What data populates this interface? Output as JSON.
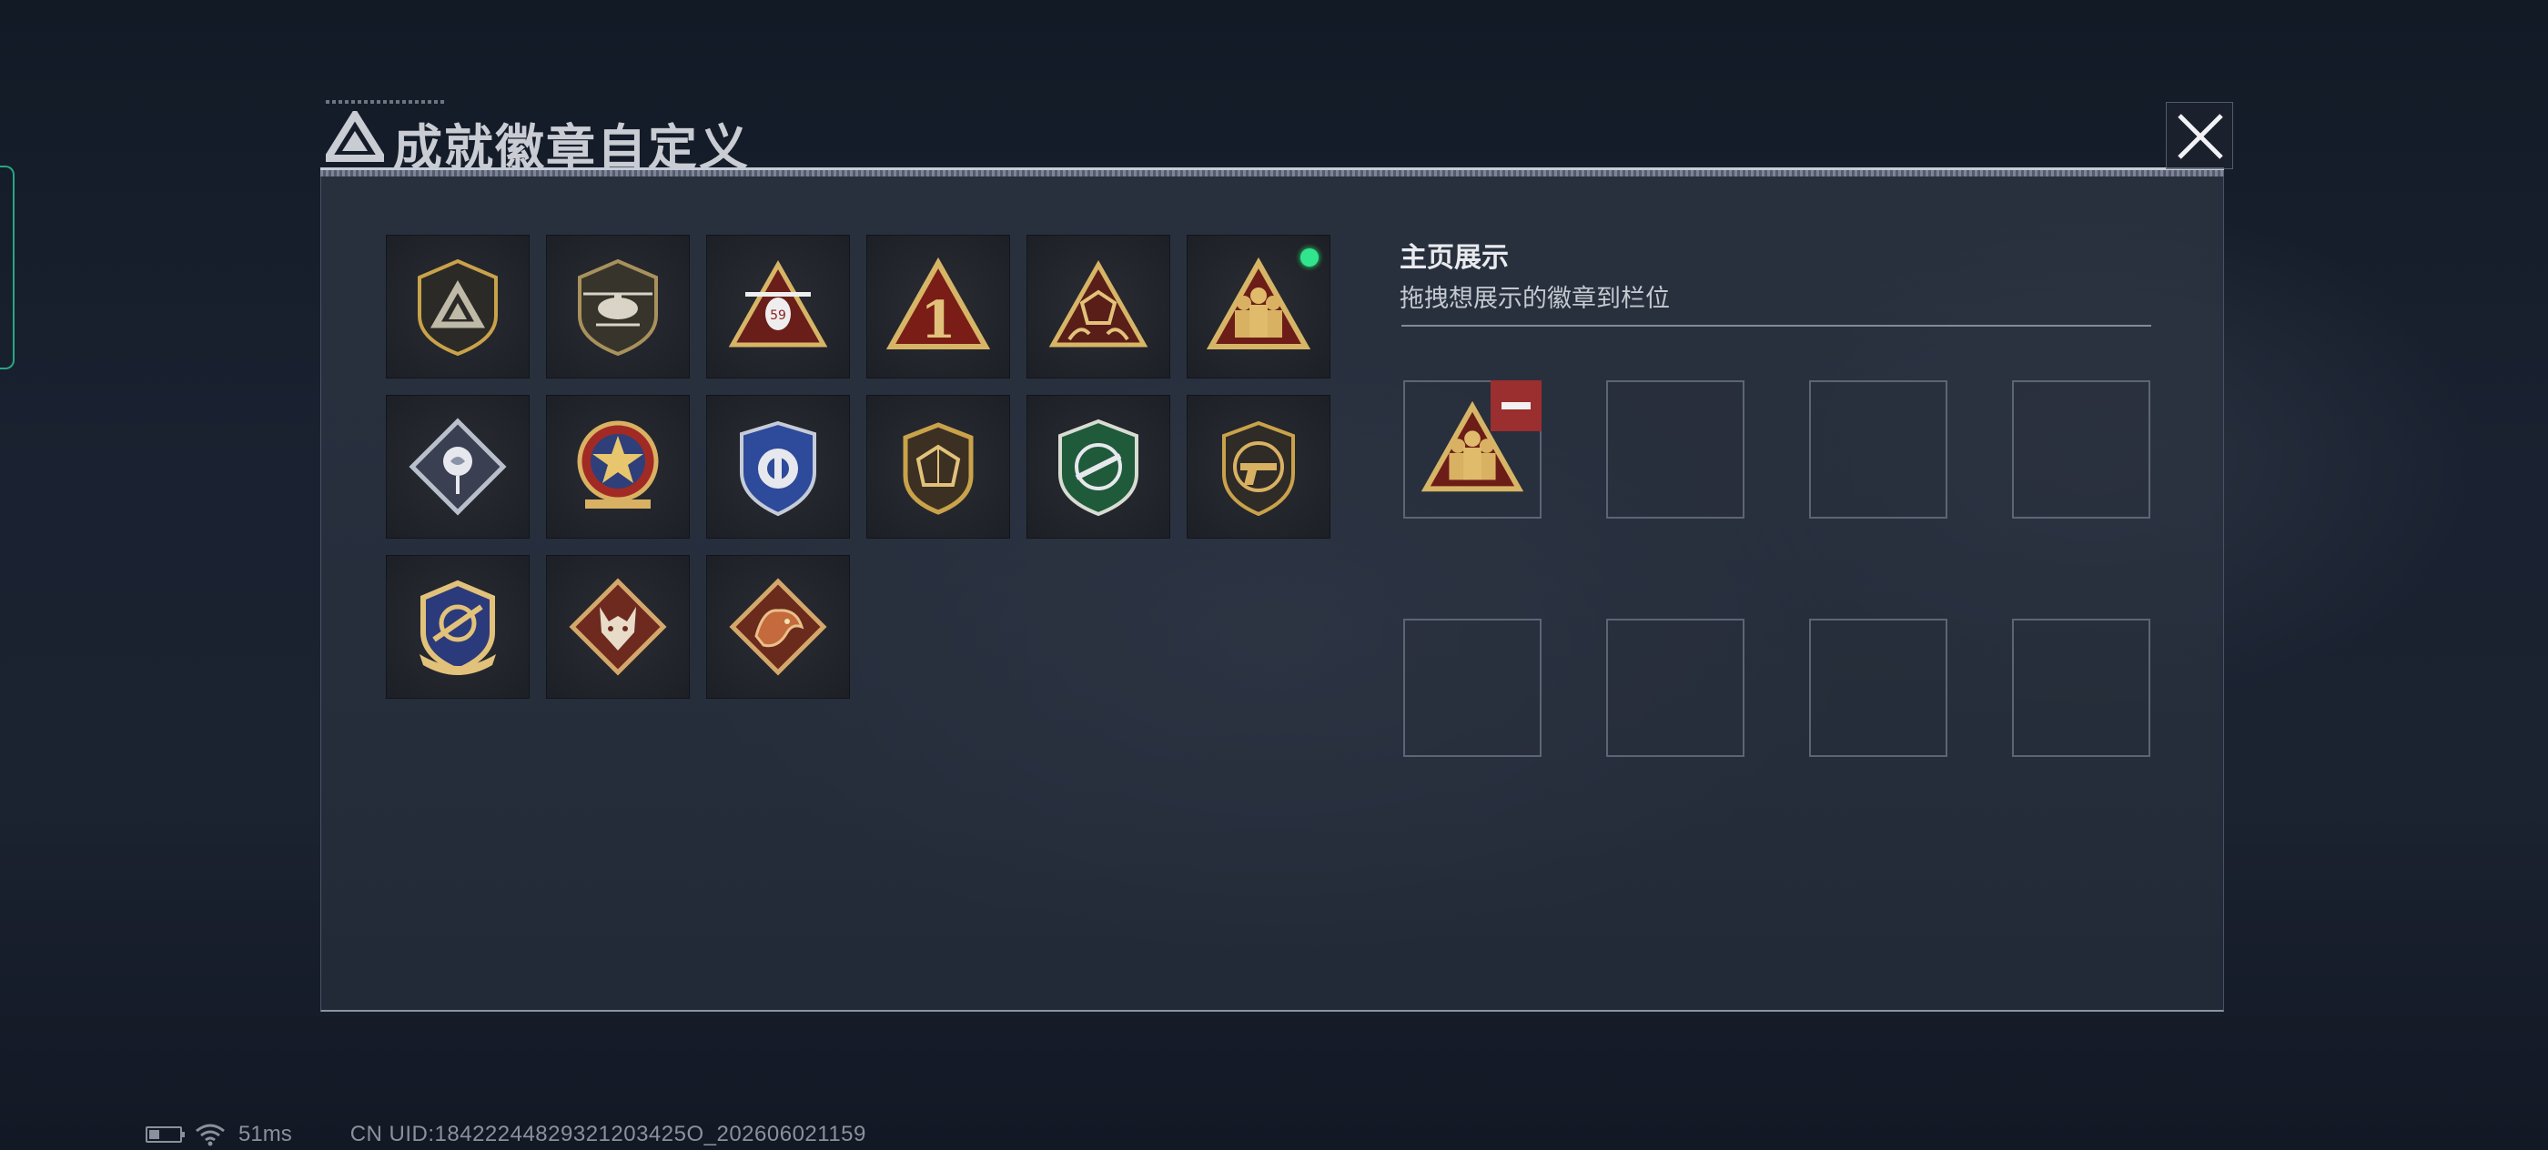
{
  "dialog": {
    "title": "成就徽章自定义",
    "close_icon": "close-icon"
  },
  "badges": [
    {
      "name": "delta-emblem-shield-badge",
      "equipped": false
    },
    {
      "name": "helicopter-shield-badge",
      "equipped": false
    },
    {
      "name": "helicopter-triangle-badge",
      "equipped": false
    },
    {
      "name": "number-one-triangle-badge",
      "equipped": false
    },
    {
      "name": "dice-triangle-badge",
      "equipped": false
    },
    {
      "name": "squad-triangle-badge",
      "equipped": true
    },
    {
      "name": "rose-diamond-badge",
      "equipped": false
    },
    {
      "name": "star-medal-badge",
      "equipped": false
    },
    {
      "name": "blue-wing-shield-badge",
      "equipped": false
    },
    {
      "name": "dice-shield-badge",
      "equipped": false
    },
    {
      "name": "green-rifle-shield-badge",
      "equipped": false
    },
    {
      "name": "pistol-shield-badge",
      "equipped": false
    },
    {
      "name": "gold-blue-crest-badge",
      "equipped": false
    },
    {
      "name": "wolf-diamond-badge",
      "equipped": false
    },
    {
      "name": "dragon-diamond-badge",
      "equipped": false
    }
  ],
  "showcase": {
    "title": "主页展示",
    "subtitle": "拖拽想展示的徽章到栏位",
    "slots": [
      {
        "badge": "squad-triangle-badge"
      },
      {
        "badge": null
      },
      {
        "badge": null
      },
      {
        "badge": null
      },
      {
        "badge": null
      },
      {
        "badge": null
      },
      {
        "badge": null
      },
      {
        "badge": null
      }
    ]
  },
  "status": {
    "ping": "51ms",
    "uid": "CN UID:18422244829321203425O_202606021159"
  },
  "colors": {
    "equipped_dot": "#31e58e",
    "remove_button": "#9b2e2e",
    "badge_gold": "#c9a24a"
  }
}
